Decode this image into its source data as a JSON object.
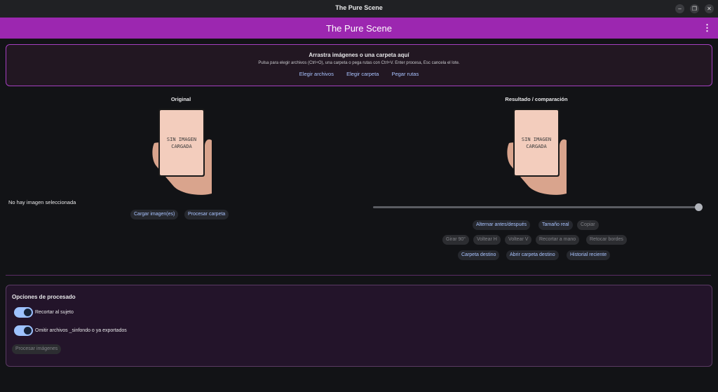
{
  "window": {
    "title": "The Pure Scene",
    "controls": [
      "minimize-icon",
      "restore-icon",
      "close-icon"
    ]
  },
  "appbar": {
    "title": "The Pure Scene",
    "menu_icon": "kebab-menu-icon"
  },
  "dropzone": {
    "title": "Arrastra imágenes o una carpeta aquí",
    "hint": "Pulsa para elegir archivos (Ctrl+O), una carpeta o pega rutas con Ctrl+V. Enter procesa, Esc cancela el lote.",
    "actions": [
      "Elegir archivos",
      "Elegir carpeta",
      "Pegar rutas"
    ]
  },
  "original": {
    "title": "Original",
    "placeholder": "SIN IMAGEN CARGADA",
    "status": "No hay imagen seleccionada",
    "buttons": [
      "Cargar imagen(es)",
      "Procesar carpeta"
    ]
  },
  "result": {
    "title": "Resultado / comparación",
    "placeholder": "SIN IMAGEN CARGADA",
    "row1": [
      "Alternar antes/después",
      "Tamaño real",
      "Copiar"
    ],
    "row2": [
      "Girar 90°",
      "Voltear H",
      "Voltear V",
      "Recortar a mano",
      "Retocar bordes"
    ],
    "row3": [
      "Carpeta destino",
      "Abrir carpeta destino",
      "Historial reciente"
    ],
    "comparison_level": 1.0
  },
  "options": {
    "title": "Opciones de procesado",
    "toggle1": {
      "label": "Recortar al sujeto",
      "on": true
    },
    "toggle2": {
      "label": "Omitir archivos _sinfondo o ya exportados",
      "on": true
    },
    "process_button": "Procesar imágenes"
  },
  "colors": {
    "accent": "#9c27b0",
    "link": "#a9c3ff",
    "bg": "#121316"
  }
}
